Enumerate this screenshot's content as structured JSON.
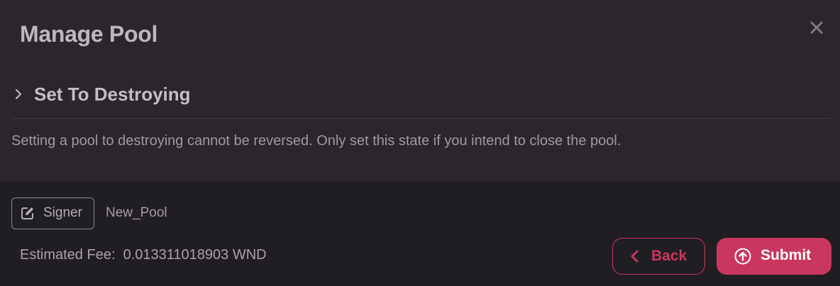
{
  "modal": {
    "title": "Manage Pool",
    "close_icon": "close-icon"
  },
  "section": {
    "title": "Set To Destroying",
    "icon": "chevron-right-icon",
    "description": "Setting a pool to destroying cannot be reversed. Only set this state if you intend to close the pool."
  },
  "signer": {
    "button_label": "Signer",
    "icon": "edit-icon",
    "name": "New_Pool"
  },
  "fee": {
    "label": "Estimated Fee:  0.013311018903 WND"
  },
  "actions": {
    "back_label": "Back",
    "back_icon": "chevron-left-icon",
    "submit_label": "Submit",
    "submit_icon": "arrow-up-circle-icon"
  },
  "colors": {
    "accent": "#c9365e",
    "panel_top": "#2a262c",
    "panel_bottom": "#211e23"
  }
}
